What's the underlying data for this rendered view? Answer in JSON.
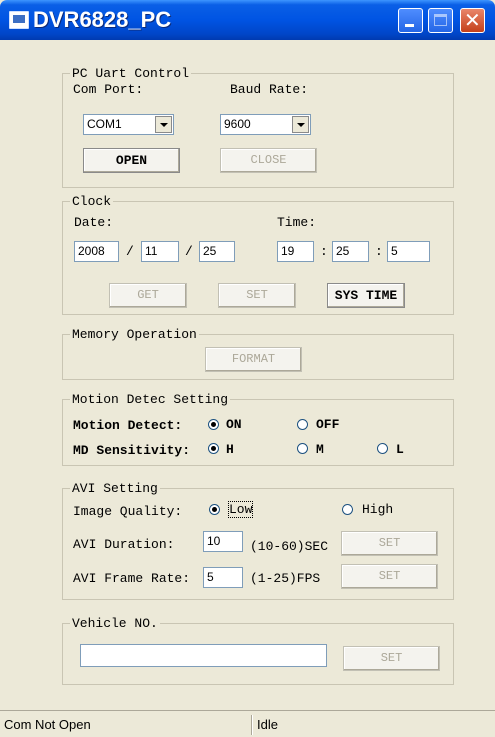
{
  "window": {
    "title": "DVR6828_PC"
  },
  "uart": {
    "legend": "PC Uart Control",
    "com_port_label": "Com Port:",
    "baud_rate_label": "Baud Rate:",
    "com_port_value": "COM1",
    "baud_rate_value": "9600",
    "open_label": "OPEN",
    "close_label": "CLOSE"
  },
  "clock": {
    "legend": "Clock",
    "date_label": "Date:",
    "time_label": "Time:",
    "year": "2008",
    "month": "11",
    "day": "25",
    "date_sep": "/",
    "time_sep": ":",
    "hour": "19",
    "minute": "25",
    "second": "5",
    "get_label": "GET",
    "set_label": "SET",
    "sys_time_label": "SYS TIME"
  },
  "memory": {
    "legend": "Memory Operation",
    "format_label": "FORMAT"
  },
  "motion": {
    "legend": "Motion Detec Setting",
    "detect_label": "Motion Detect:",
    "on_label": "ON",
    "off_label": "OFF",
    "sensitivity_label": "MD Sensitivity:",
    "h_label": "H",
    "m_label": "M",
    "l_label": "L"
  },
  "avi": {
    "legend": "AVI Setting",
    "quality_label": "Image Quality:",
    "low_label": "Low",
    "high_label": "High",
    "duration_label": "AVI Duration:",
    "duration_value": "10",
    "duration_range": "(10-60)SEC",
    "framerate_label": "AVI Frame Rate:",
    "framerate_value": "5",
    "framerate_range": "(1-25)FPS",
    "set_label": "SET"
  },
  "vehicle": {
    "legend": "Vehicle NO.",
    "value": "",
    "set_label": "SET"
  },
  "status": {
    "left": "Com Not Open",
    "right": "Idle"
  }
}
